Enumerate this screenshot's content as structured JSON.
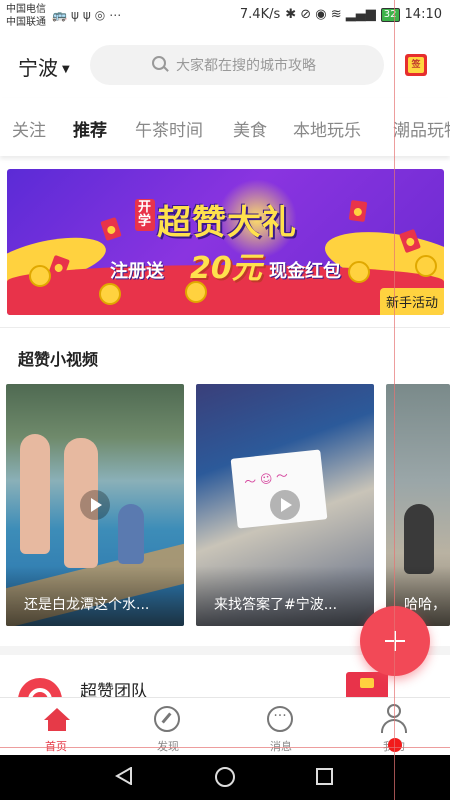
{
  "status_bar": {
    "carrier1": "中国电信",
    "carrier2": "中国联通",
    "speed": "7.4K/s",
    "battery": "32",
    "time": "14:10"
  },
  "header": {
    "city": "宁波",
    "search_placeholder": "大家都在搜的城市攻略",
    "checkin_icon": "签"
  },
  "tabs": [
    {
      "label": "关注",
      "active": false
    },
    {
      "label": "推荐",
      "active": true
    },
    {
      "label": "午茶时间",
      "active": false
    },
    {
      "label": "美食",
      "active": false
    },
    {
      "label": "本地玩乐",
      "active": false
    },
    {
      "label": "潮品玩物",
      "active": false
    }
  ],
  "banner": {
    "kai_label": "开学",
    "title": "超赞大礼",
    "sub_a": "注册送",
    "amount": "20元",
    "sub_b": "现金红包",
    "tag": "新手活动"
  },
  "videos": {
    "section_title": "超赞小视频",
    "items": [
      {
        "caption": "还是白龙潭这个水..."
      },
      {
        "caption": "来找答案了#宁波..."
      },
      {
        "caption": "哈哈，"
      }
    ]
  },
  "team": {
    "name": "超赞团队"
  },
  "bottom_nav": [
    {
      "label": "首页",
      "icon": "home-icon",
      "active": true
    },
    {
      "label": "发现",
      "icon": "discover-icon",
      "active": false
    },
    {
      "label": "消息",
      "icon": "message-icon",
      "active": false
    },
    {
      "label": "我的",
      "icon": "profile-icon",
      "active": false
    }
  ],
  "colors": {
    "accent": "#e63a48",
    "fab": "#f24957"
  }
}
